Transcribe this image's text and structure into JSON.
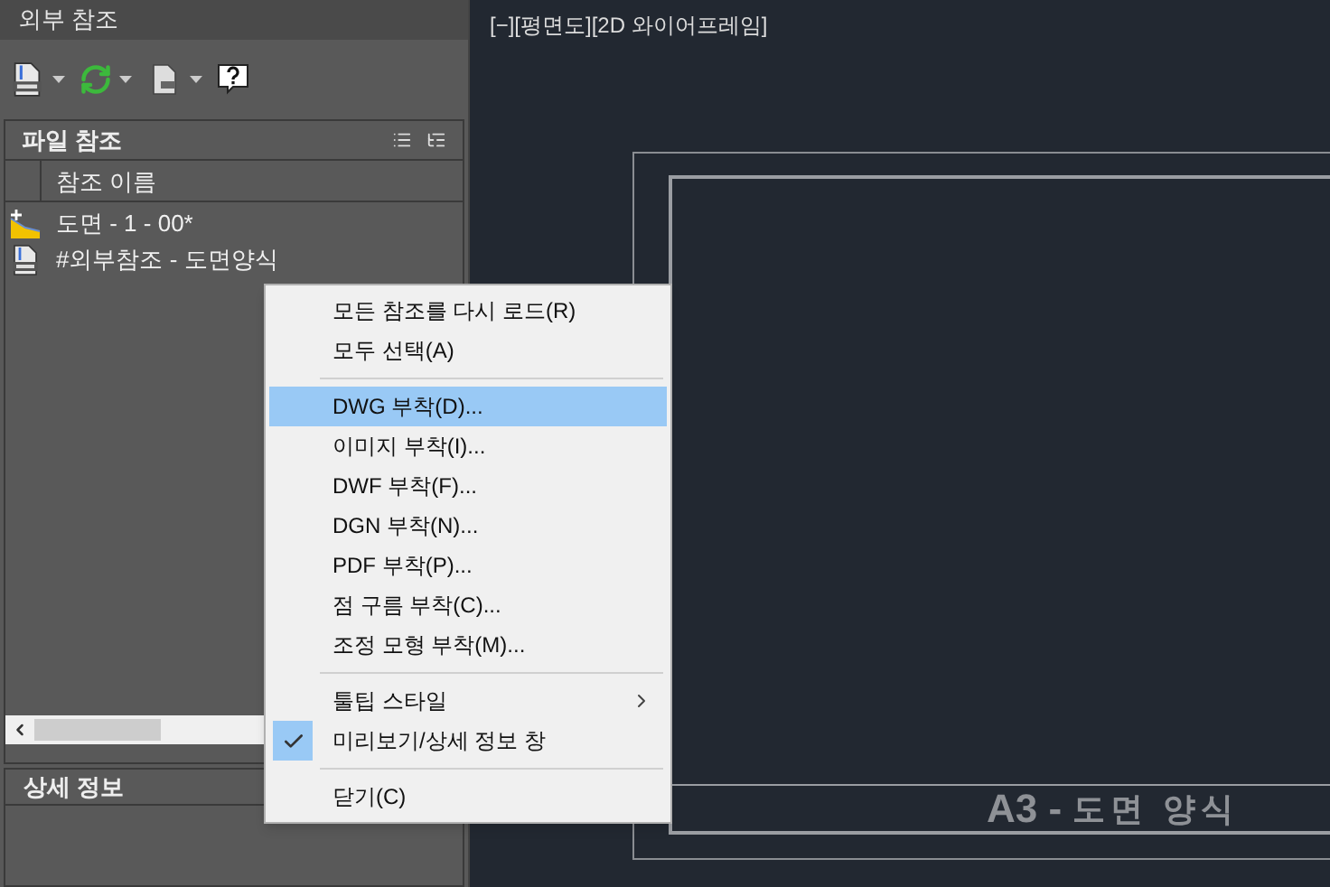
{
  "panel": {
    "title": "외부 참조"
  },
  "toolbar": [
    {
      "kind": "attach",
      "has_dropdown": true
    },
    {
      "kind": "refresh",
      "has_dropdown": true
    },
    {
      "kind": "change-path",
      "has_dropdown": true
    },
    {
      "kind": "help",
      "has_dropdown": false
    }
  ],
  "file_references": {
    "title": "파일 참조",
    "column_header": "참조 이름",
    "rows": [
      {
        "kind": "drawing",
        "name": "도면 - 1 - 00*"
      },
      {
        "kind": "dwg",
        "name": "#외부참조 - 도면양식"
      }
    ]
  },
  "details": {
    "title": "상세 정보"
  },
  "viewport": {
    "label": "[−][평면도][2D 와이어프레임]",
    "title_code": "A3 -",
    "title_name": "도면 양식"
  },
  "context_menu": [
    {
      "kind": "item",
      "label": "모든 참조를 다시 로드(R)",
      "selected": false,
      "checked": false,
      "has_submenu": false
    },
    {
      "kind": "item",
      "label": "모두 선택(A)",
      "selected": false,
      "checked": false,
      "has_submenu": false
    },
    {
      "kind": "separator"
    },
    {
      "kind": "item",
      "label": "DWG 부착(D)...",
      "selected": true,
      "checked": false,
      "has_submenu": false
    },
    {
      "kind": "item",
      "label": "이미지 부착(I)...",
      "selected": false,
      "checked": false,
      "has_submenu": false
    },
    {
      "kind": "item",
      "label": "DWF 부착(F)...",
      "selected": false,
      "checked": false,
      "has_submenu": false
    },
    {
      "kind": "item",
      "label": "DGN 부착(N)...",
      "selected": false,
      "checked": false,
      "has_submenu": false
    },
    {
      "kind": "item",
      "label": "PDF 부착(P)...",
      "selected": false,
      "checked": false,
      "has_submenu": false
    },
    {
      "kind": "item",
      "label": "점 구름 부착(C)...",
      "selected": false,
      "checked": false,
      "has_submenu": false
    },
    {
      "kind": "item",
      "label": "조정 모형 부착(M)...",
      "selected": false,
      "checked": false,
      "has_submenu": false
    },
    {
      "kind": "separator"
    },
    {
      "kind": "item",
      "label": "툴팁 스타일",
      "selected": false,
      "checked": false,
      "has_submenu": true
    },
    {
      "kind": "item",
      "label": "미리보기/상세 정보 창",
      "selected": false,
      "checked": true,
      "has_submenu": false
    },
    {
      "kind": "separator"
    },
    {
      "kind": "item",
      "label": "닫기(C)",
      "selected": false,
      "checked": false,
      "has_submenu": false
    }
  ]
}
